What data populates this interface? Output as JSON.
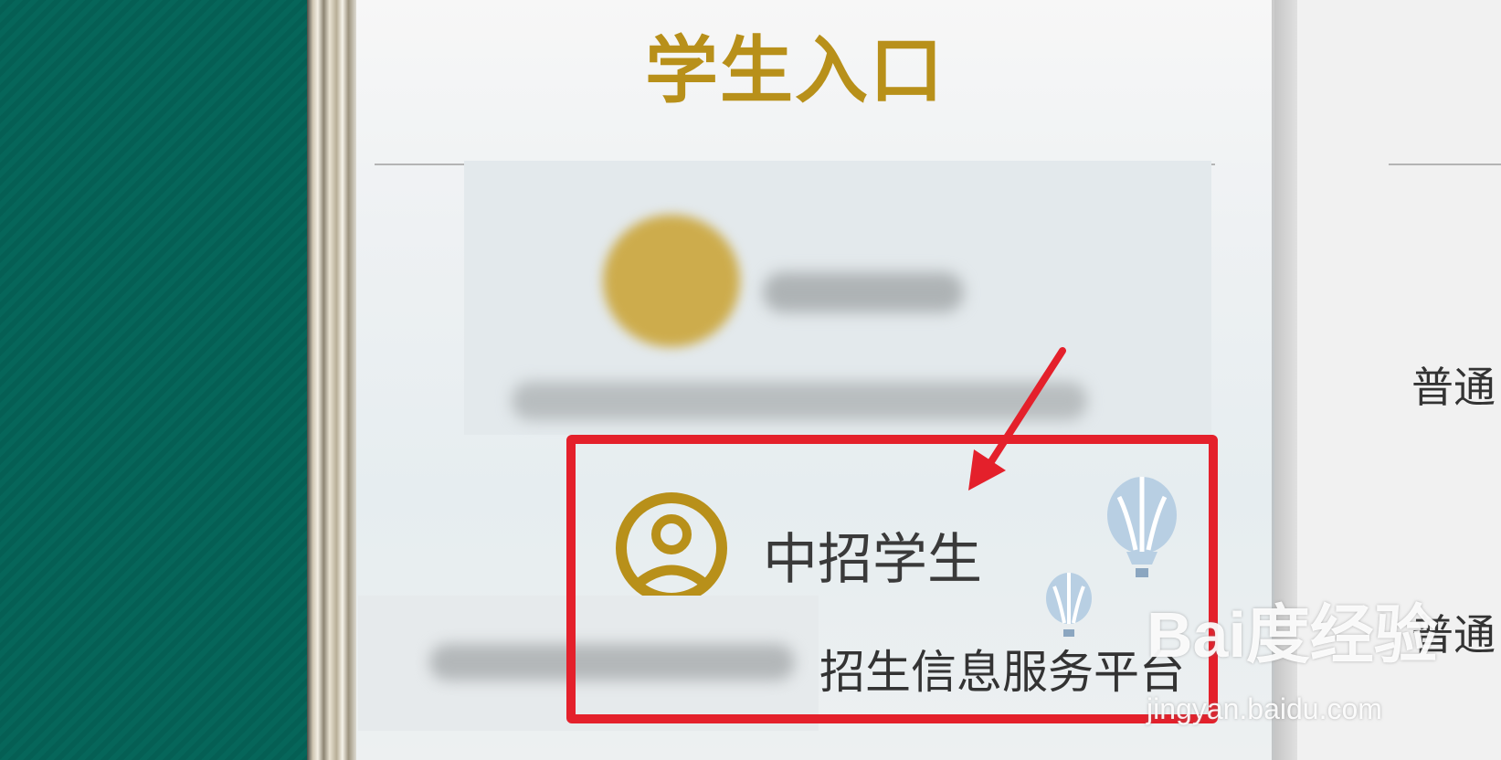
{
  "page": {
    "title": "学生入口"
  },
  "student_entry": {
    "label": "中招学生"
  },
  "platform": {
    "text": "招生信息服务平台"
  },
  "side_items": [
    "普通",
    "普通"
  ],
  "watermark": {
    "brand": "Bai度经验",
    "url": "jingyan.baidu.com"
  },
  "colors": {
    "accent": "#b8901a",
    "highlight": "#e4202b",
    "background_left": "#06665a"
  },
  "icons": {
    "student_entry": "user-circle-icon",
    "balloons": "hot-air-balloon-icon",
    "pointer": "red-arrow-icon"
  }
}
